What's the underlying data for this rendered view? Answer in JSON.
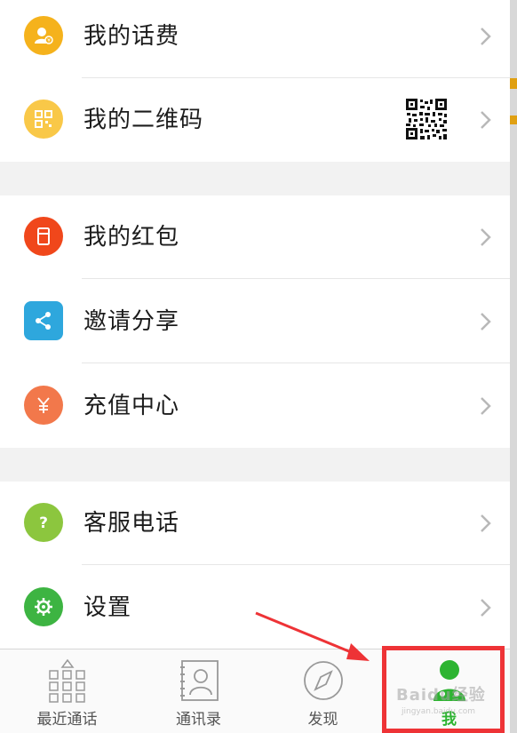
{
  "menu": {
    "group1": [
      {
        "label": "我的话费",
        "icon": "phone-bill-icon",
        "color": "#f5b21c"
      },
      {
        "label": "我的二维码",
        "icon": "qr-code-icon",
        "color": "#f9c848"
      }
    ],
    "group2": [
      {
        "label": "我的红包",
        "icon": "red-envelope-icon",
        "color": "#f0471b"
      },
      {
        "label": "邀请分享",
        "icon": "share-icon",
        "color": "#2ea7dd"
      },
      {
        "label": "充值中心",
        "icon": "yuan-icon",
        "color": "#f2784b"
      }
    ],
    "group3": [
      {
        "label": "客服电话",
        "icon": "question-icon",
        "color": "#8cc63e"
      },
      {
        "label": "设置",
        "icon": "gear-icon",
        "color": "#3db442"
      }
    ]
  },
  "tabbar": {
    "tabs": [
      {
        "label": "最近通话",
        "icon": "dialpad-icon"
      },
      {
        "label": "通讯录",
        "icon": "contacts-icon"
      },
      {
        "label": "发现",
        "icon": "compass-icon"
      },
      {
        "label": "我",
        "icon": "profile-icon",
        "active": true
      }
    ]
  },
  "colors": {
    "active_tab": "#2db431",
    "highlight": "#ee3336",
    "chevron": "#b8b8b8",
    "group_gap": "#f2f2f2"
  },
  "watermark": {
    "brand": "Baidu经验",
    "url": "jingyan.baidu.com"
  }
}
